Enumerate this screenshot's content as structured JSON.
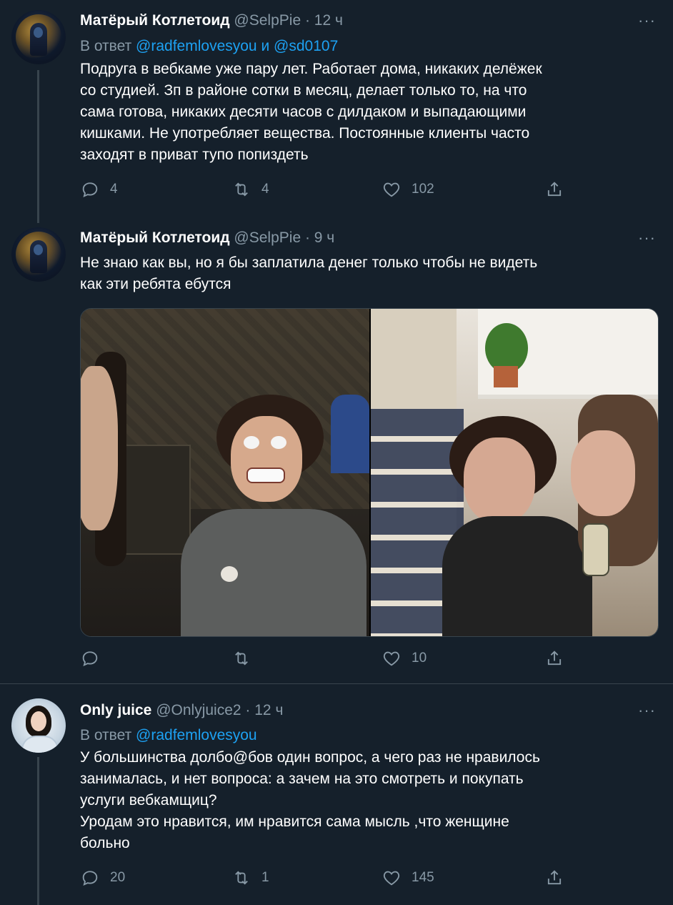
{
  "tweets": [
    {
      "name": "Матёрый Котлетоид",
      "meta": "@SelpPie · 12 ч",
      "reply_prefix": "В ответ",
      "reply_mention1": "@radfemlovesyou",
      "reply_and": "и",
      "reply_mention2": "@sd0107",
      "text": "Подруга в вебкаме уже пару лет. Работает дома, никаких делёжек\nсо студией. Зп в районе сотки в месяц, делает только то, на что\nсама готова, никаких десяти часов с дилдаком и выпадающими\nкишками. Не употребляет вещества. Постоянные клиенты часто\nзаходят в приват тупо попиздеть",
      "replies": "4",
      "retweets": "4",
      "likes": "102",
      "more": "···"
    },
    {
      "name": "Матёрый Котлетоид",
      "meta": "@SelpPie · 9 ч",
      "text": "Не знаю как вы, но я бы заплатила денег только чтобы не видеть\nкак эти ребята ебутся",
      "replies": "",
      "retweets": "",
      "likes": "10",
      "more": "···"
    },
    {
      "name": "Only juice",
      "meta": "@Onlyjuice2 · 12 ч",
      "reply_prefix": "В ответ",
      "reply_mention1": "@radfemlovesyou",
      "text": "У большинства долбо@бов один вопрос, а чего раз не нравилось\nзанималась, и нет вопроса: а зачем на это смотреть и покупать\nуслуги вебкамщиц?\nУродам это нравится, им нравится сама мысль ,что женщине\nбольно",
      "replies": "20",
      "retweets": "1",
      "likes": "145",
      "more": "···"
    }
  ],
  "colors": {
    "background": "#15202b",
    "secondary_text": "#8899a6",
    "link": "#1da1f2",
    "divider": "#38444d"
  },
  "icons": [
    "reply-icon",
    "retweet-icon",
    "like-icon",
    "share-icon",
    "more-icon"
  ]
}
